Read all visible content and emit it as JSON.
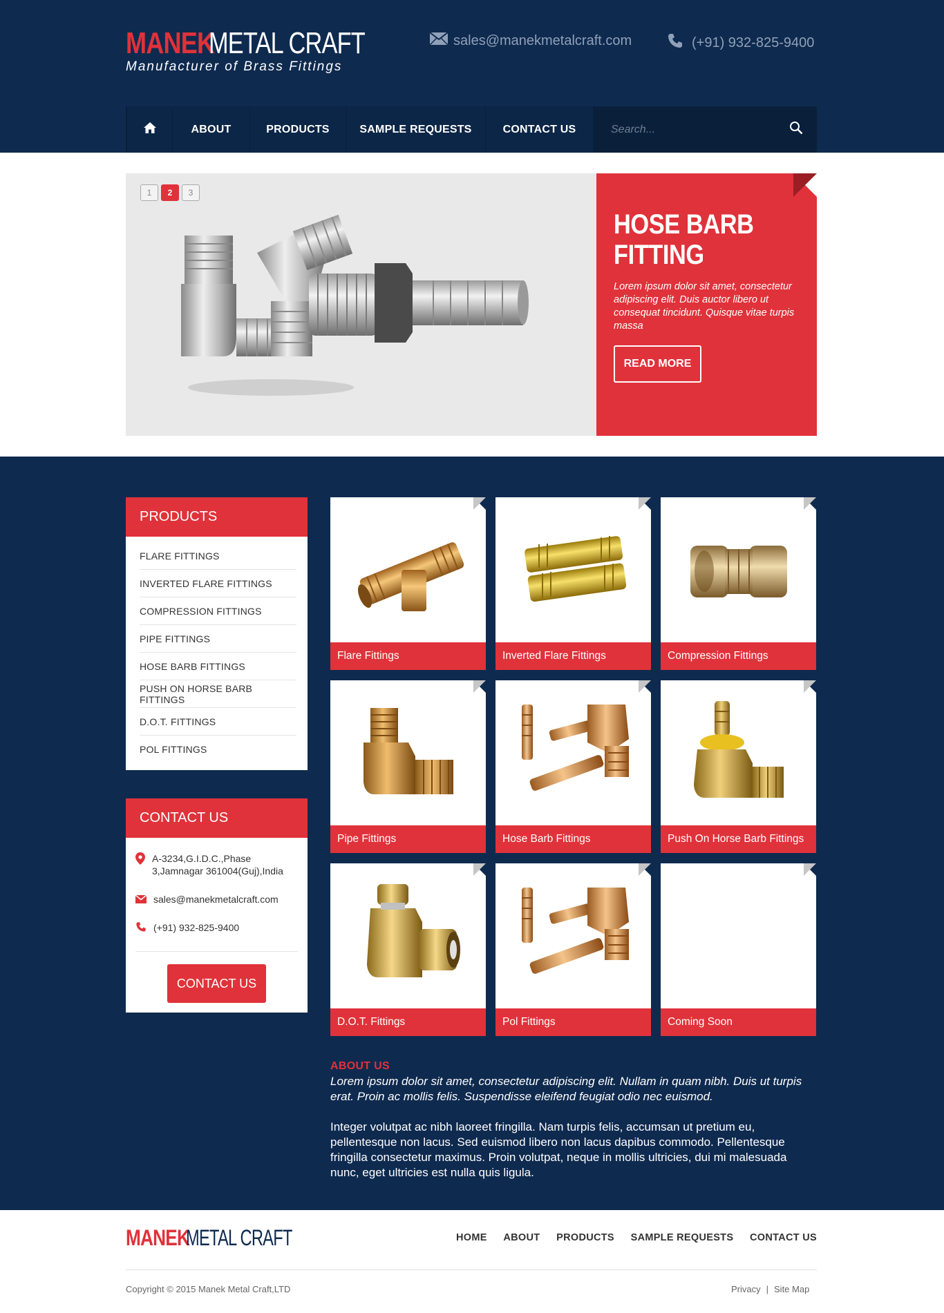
{
  "header": {
    "logo_word1": "MANEK",
    "logo_word2": "METAL CRAFT",
    "tagline": "Manufacturer of Brass Fittings",
    "email": "sales@manekmetalcraft.com",
    "phone": "(+91) 932-825-9400"
  },
  "nav": {
    "items": [
      "ABOUT",
      "PRODUCTS",
      "SAMPLE REQUESTS",
      "CONTACT US"
    ],
    "search_placeholder": "Search..."
  },
  "slider": {
    "pages": [
      "1",
      "2",
      "3"
    ],
    "active_page": "2",
    "title": "HOSE BARB FITTING",
    "text": "Lorem ipsum dolor sit amet, consectetur adipiscing elit. Duis auctor libero ut consequat tincidunt. Quisque vitae turpis massa",
    "button": "READ MORE"
  },
  "sidebar": {
    "products_title": "PRODUCTS",
    "products": [
      "FLARE FITTINGS",
      "INVERTED FLARE FITTINGS",
      "COMPRESSION FITTINGS",
      "PIPE FITTINGS",
      "HOSE BARB FITTINGS",
      "PUSH ON HORSE BARB FITTINGS",
      "D.O.T. FITTINGS",
      "POL FITTINGS"
    ],
    "contact_title": "CONTACT US",
    "address": "A-3234,G.I.D.C.,Phase 3,Jamnagar 361004(Guj),India",
    "email": "sales@manekmetalcraft.com",
    "phone": "(+91) 932-825-9400",
    "contact_button": "CONTACT US"
  },
  "cards": [
    "Flare Fittings",
    "Inverted Flare Fittings",
    "Compression Fittings",
    "Pipe Fittings",
    "Hose Barb Fittings",
    "Push On Horse Barb Fittings",
    "D.O.T. Fittings",
    "Pol Fittings",
    "Coming Soon"
  ],
  "about": {
    "title": "ABOUT US",
    "lead": "Lorem ipsum dolor sit amet, consectetur adipiscing elit. Nullam in quam nibh. Duis ut turpis erat. Proin ac mollis felis. Suspendisse eleifend feugiat odio nec euismod.",
    "body": "Integer volutpat ac nibh laoreet fringilla. Nam turpis felis, accumsan ut pretium eu, pellentesque non lacus. Sed euismod libero non lacus dapibus commodo. Pellentesque fringilla consectetur maximus. Proin volutpat, neque in mollis ultricies, dui mi malesuada nunc, eget ultricies est nulla quis ligula."
  },
  "footer": {
    "logo_word1": "MANEK",
    "logo_word2": "METAL CRAFT",
    "nav": [
      "HOME",
      "ABOUT",
      "PRODUCTS",
      "SAMPLE REQUESTS",
      "CONTACT US"
    ],
    "copyright": "Copyright © 2015 Manek Metal Craft,LTD",
    "links": [
      "Privacy",
      "|",
      "Site Map"
    ]
  },
  "colors": {
    "navy": "#0f2a4f",
    "red": "#e0323a"
  }
}
